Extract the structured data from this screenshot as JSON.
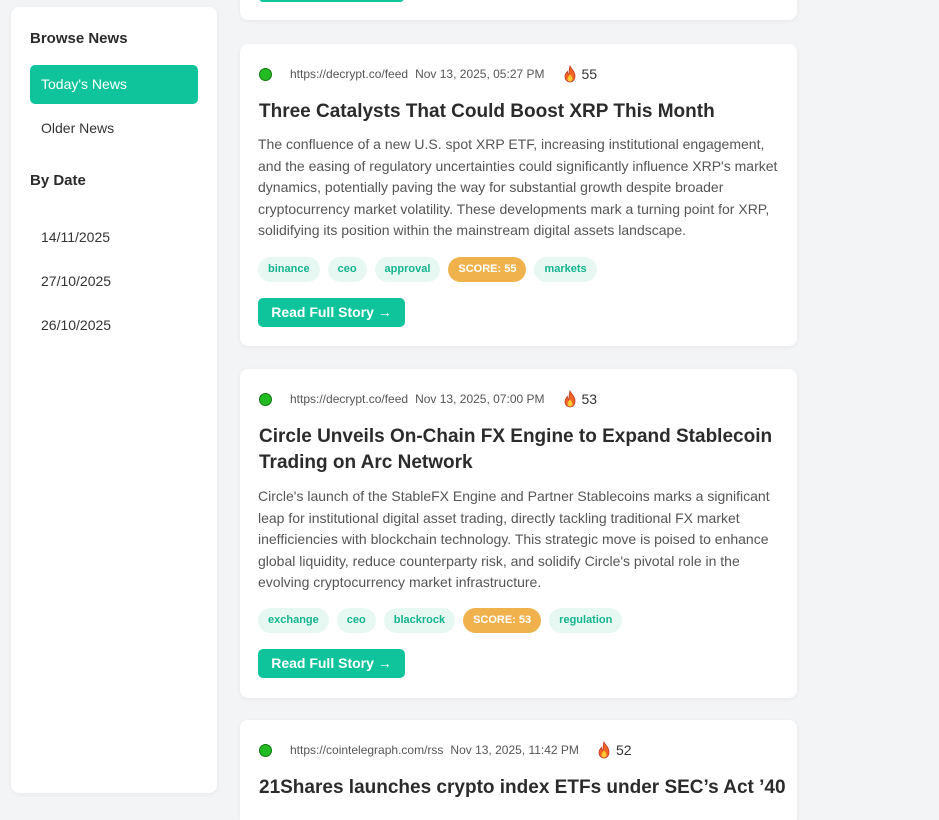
{
  "sidebar": {
    "browse_heading": "Browse News",
    "todays_news": "Today's News",
    "older_news": "Older News",
    "by_date_heading": "By Date",
    "dates": [
      "14/11/2025",
      "27/10/2025",
      "26/10/2025"
    ]
  },
  "colors": {
    "accent": "#0fc49b",
    "score_badge": "#f0b24d",
    "status_dot": "#22bb22"
  },
  "articles": [
    {
      "source": "https://decrypt.co/feed",
      "date": "Nov 13, 2025, 05:27 PM",
      "hot_icon": "fire-icon",
      "hot_score": "55",
      "title": "Three Catalysts That Could Boost XRP This Month",
      "summary": "The confluence of a new U.S. spot XRP ETF, increasing institutional engagement, and the easing of regulatory uncertainties could significantly influence XRP's market dynamics, potentially paving the way for substantial growth despite broader cryptocurrency market volatility. These developments mark a turning point for XRP, solidifying its position within the mainstream digital assets landscape.",
      "tags": [
        "binance",
        "ceo",
        "approval",
        "SCORE: 55",
        "markets"
      ],
      "read_label": "Read Full Story →"
    },
    {
      "source": "https://decrypt.co/feed",
      "date": "Nov 13, 2025, 07:00 PM",
      "hot_icon": "fire-icon",
      "hot_score": "53",
      "title": "Circle Unveils On-Chain FX Engine to Expand Stablecoin Trading on Arc Network",
      "summary": "Circle's launch of the StableFX Engine and Partner Stablecoins marks a significant leap for institutional digital asset trading, directly tackling traditional FX market inefficiencies with blockchain technology. This strategic move is poised to enhance global liquidity, reduce counterparty risk, and solidify Circle's pivotal role in the evolving cryptocurrency market infrastructure.",
      "tags": [
        "exchange",
        "ceo",
        "blackrock",
        "SCORE: 53",
        "regulation"
      ],
      "read_label": "Read Full Story →"
    },
    {
      "source": "https://cointelegraph.com/rss",
      "date": "Nov 13, 2025, 11:42 PM",
      "hot_icon": "fire-icon",
      "hot_score": "52",
      "title": "21Shares launches crypto index ETFs under SEC’s Act ’40"
    }
  ]
}
